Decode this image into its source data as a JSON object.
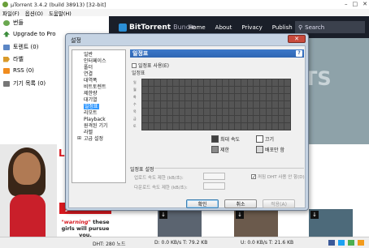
{
  "app": {
    "title": "µTorrent 3.4.2  (build 38913) [32-bit]",
    "window_controls": [
      "–",
      "□",
      "✕"
    ]
  },
  "menu": [
    "파일(F)",
    "옵션(O)",
    "도움말(H)"
  ],
  "sidebar": {
    "items": [
      {
        "label": "번들",
        "icon": "bundle-icon"
      },
      {
        "label": "Upgrade to Pro",
        "icon": "upgrade-icon"
      },
      {
        "label": "토렌트 (0)",
        "icon": "torrents-icon"
      },
      {
        "label": "라벨",
        "icon": "label-icon"
      },
      {
        "label": "RSS (0)",
        "icon": "rss-icon"
      },
      {
        "label": "기기 목록 (0)",
        "icon": "devices-icon"
      }
    ]
  },
  "bundle": {
    "logo": "BitTorrent",
    "logo_sub": "Bundle",
    "nav": [
      "Home",
      "About",
      "Privacy",
      "Publish"
    ],
    "search_label": "Search",
    "ghost_text": "TS"
  },
  "ads": {
    "big_text": "Li",
    "join_text": "Join Now!",
    "warning_prefix": "\"warning\"",
    "warning_text": "these girls will pursue you."
  },
  "status": {
    "dht": "DHT: 280 노드",
    "down": "D: 0.0 KB/s T: 79.2 KB",
    "up": "U: 0.0 KB/s T: 21.6 KB"
  },
  "dialog": {
    "title": "설정",
    "close": "✕",
    "tree": [
      {
        "label": "일반",
        "expander": ""
      },
      {
        "label": "인터페이스",
        "expander": ""
      },
      {
        "label": "폴더",
        "expander": ""
      },
      {
        "label": "연결",
        "expander": ""
      },
      {
        "label": "대역폭",
        "expander": ""
      },
      {
        "label": "비트토렌트",
        "expander": ""
      },
      {
        "label": "제한량",
        "expander": ""
      },
      {
        "label": "대기열",
        "expander": ""
      },
      {
        "label": "일정표",
        "expander": "",
        "selected": true
      },
      {
        "label": "리모트",
        "expander": ""
      },
      {
        "label": "Playback",
        "expander": ""
      },
      {
        "label": "원격된 기기",
        "expander": ""
      },
      {
        "label": "라벨",
        "expander": ""
      },
      {
        "label": "고급 설정",
        "expander": "⊞"
      }
    ],
    "panel": {
      "header": "일정표",
      "help": "?",
      "enable_schedule": "일정표 사용(E)",
      "schedule_label": "일정표",
      "days": [
        "일",
        "월",
        "화",
        "수",
        "목",
        "금",
        "토"
      ],
      "legend": [
        {
          "label": "최대 속도",
          "color": "#404040"
        },
        {
          "label": "끄기",
          "color": "#ffffff"
        },
        {
          "label": "제한",
          "color": "#8a8a8a"
        },
        {
          "label": "배포만 함",
          "color": "#d8d8d8"
        }
      ],
      "settings_title": "일정표 설정",
      "upload_limit_label": "업로드 속도 제한 (kB/초):",
      "download_limit_label": "다운로드 속도 제한 (kB/초):",
      "dht_label": "꺼짐 DHT 사용 안 함(D)"
    },
    "buttons": {
      "ok": "확인",
      "cancel": "취소",
      "apply": "적용(A)"
    }
  }
}
